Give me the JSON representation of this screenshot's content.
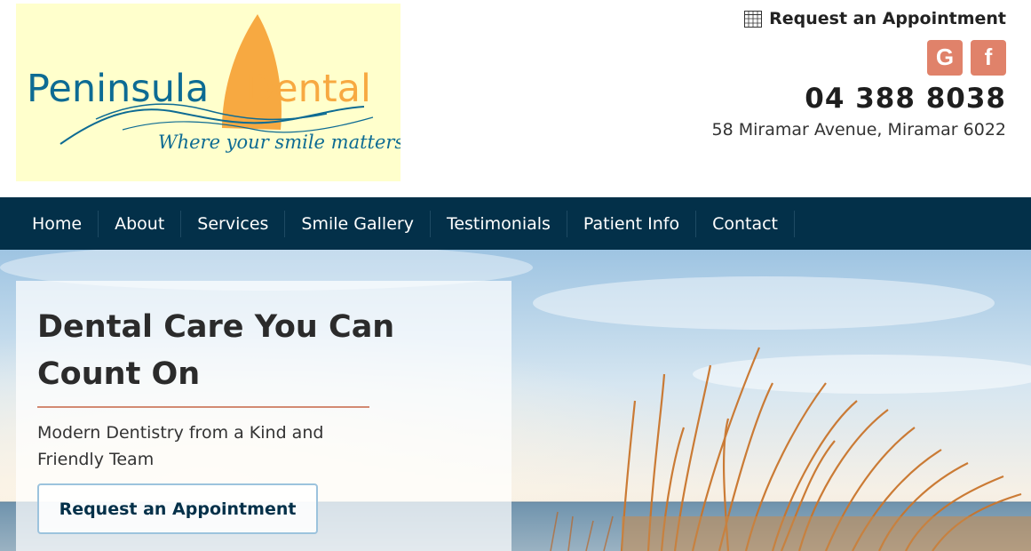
{
  "logo": {
    "name_part1": "Peninsula",
    "name_part2": "Dental",
    "tagline": "Where your smile matters"
  },
  "header": {
    "appointment_label": "Request an Appointment",
    "social": [
      {
        "glyph": "G",
        "icon": "google-icon"
      },
      {
        "glyph": "f",
        "icon": "facebook-icon"
      }
    ],
    "phone": "04 388 8038",
    "address": "58 Miramar Avenue, Miramar 6022"
  },
  "nav": {
    "items": [
      "Home",
      "About",
      "Services",
      "Smile Gallery",
      "Testimonials",
      "Patient Info",
      "Contact"
    ]
  },
  "hero": {
    "title": "Dental Care You Can Count On",
    "subtitle": "Modern Dentistry from a Kind and Friendly Team",
    "button_label": "Request an Appointment"
  },
  "colors": {
    "nav_bg": "#033049",
    "accent": "#e0826a",
    "logo_bg": "#ffffcc",
    "logo_blue": "#0d6b93",
    "sail": "#f7a941"
  }
}
